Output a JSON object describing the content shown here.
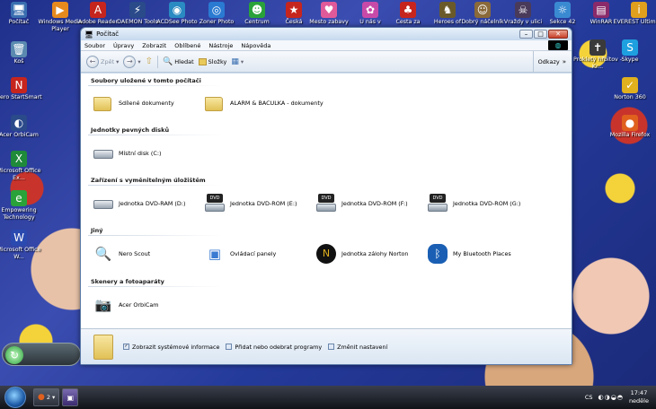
{
  "desktop": {
    "icons_top": [
      {
        "label": "Počítač",
        "glyph": "🖥",
        "color": "#3a6fb0"
      },
      {
        "label": "Windows Media Player",
        "glyph": "▶",
        "color": "#e78a1e"
      },
      {
        "label": "Adobe Reader",
        "glyph": "A",
        "color": "#c6251e"
      },
      {
        "label": "DAEMON Tools",
        "glyph": "⚡",
        "color": "#2a4a8a"
      },
      {
        "label": "ACDSee Photo",
        "glyph": "◉",
        "color": "#2a8ac2"
      },
      {
        "label": "Zoner Photo",
        "glyph": "◎",
        "color": "#2a7ad2"
      },
      {
        "label": "Centrum",
        "glyph": "☻",
        "color": "#2aa23a"
      },
      {
        "label": "Česká",
        "glyph": "★",
        "color": "#c6251e"
      },
      {
        "label": "Mesto zabavy",
        "glyph": "♥",
        "color": "#e05a9a"
      },
      {
        "label": "U nás v",
        "glyph": "✿",
        "color": "#c84aa8"
      },
      {
        "label": "Cesta za",
        "glyph": "♣",
        "color": "#c6251e"
      },
      {
        "label": "Heroes of",
        "glyph": "♞",
        "color": "#6a5a2a"
      },
      {
        "label": "Dobrý náčelník",
        "glyph": "☺",
        "color": "#8a6a3a"
      },
      {
        "label": "Vraždy v ulici",
        "glyph": "☠",
        "color": "#4a3a5a"
      },
      {
        "label": "Sekce 42",
        "glyph": "☼",
        "color": "#3a8ad2"
      },
      {
        "label": "WinRAR",
        "glyph": "▤",
        "color": "#8a2a6a"
      },
      {
        "label": "EVEREST Ultima...",
        "glyph": "i",
        "color": "#e0a01e"
      }
    ],
    "icons_left": [
      {
        "label": "Koš",
        "glyph": "🗑",
        "color": "#5a8ab0"
      },
      {
        "label": "Nero StartSmart",
        "glyph": "N",
        "color": "#c6251e"
      },
      {
        "label": "Acer OrbiCam",
        "glyph": "◐",
        "color": "#2a4a8a"
      },
      {
        "label": "Microsoft Office Ex...",
        "glyph": "X",
        "color": "#1e8a3a"
      },
      {
        "label": "Empowering Technology",
        "glyph": "e",
        "color": "#2aa23a"
      },
      {
        "label": "Microsoft Office W...",
        "glyph": "W",
        "color": "#2a4ab0"
      }
    ],
    "icons_right": [
      {
        "label": "Prokletý hřbitov - Kr...",
        "glyph": "✝",
        "color": "#3a3a3a"
      },
      {
        "label": "Skype",
        "glyph": "S",
        "color": "#1ea0e0"
      },
      {
        "label": "Norton 360",
        "glyph": "✓",
        "color": "#e0b01e"
      },
      {
        "label": "Mozilla Firefox",
        "glyph": "●",
        "color": "#e0601e"
      }
    ]
  },
  "window": {
    "title": "Počítač",
    "menu": [
      "Soubor",
      "Úpravy",
      "Zobrazit",
      "Oblíbené",
      "Nástroje",
      "Nápověda"
    ],
    "toolbar": {
      "back": "Zpět",
      "search": "Hledat",
      "folders": "Složky",
      "links": "Odkazy"
    },
    "groups": [
      {
        "title": "Soubory uložené v tomto počítači"
      },
      {
        "title": "Jednotky pevných disků"
      },
      {
        "title": "Zařízení s vyměnitelným úložištěm"
      },
      {
        "title": "Jiný"
      },
      {
        "title": "Skenery a fotoaparáty"
      }
    ],
    "items": {
      "shared_docs": "Sdílené dokumenty",
      "alarm_docs": "ALARM & BACULKA - dokumenty",
      "local_disk": "Místní disk (C:)",
      "dvd_ram": "Jednotka DVD-RAM (D:)",
      "dvd_rom_e": "Jednotka DVD-ROM (E:)",
      "dvd_rom_f": "Jednotka DVD-ROM (F:)",
      "dvd_rom_g": "Jednotka DVD-ROM (G:)",
      "nero_scout": "Nero Scout",
      "control_panel": "Ovládací panely",
      "norton_backup": "Jednotka zálohy Norton",
      "bluetooth": "My Bluetooth Places",
      "orbicam": "Acer OrbiCam",
      "dvd_badge": "DVD"
    },
    "details": {
      "system_info": "Zobrazit systémové informace",
      "add_remove": "Přidat nebo odebrat programy",
      "change_settings": "Změnit nastavení"
    }
  },
  "taskbar": {
    "firefox_count": "2",
    "lang": "CS",
    "time": "17:47",
    "day": "neděle"
  }
}
